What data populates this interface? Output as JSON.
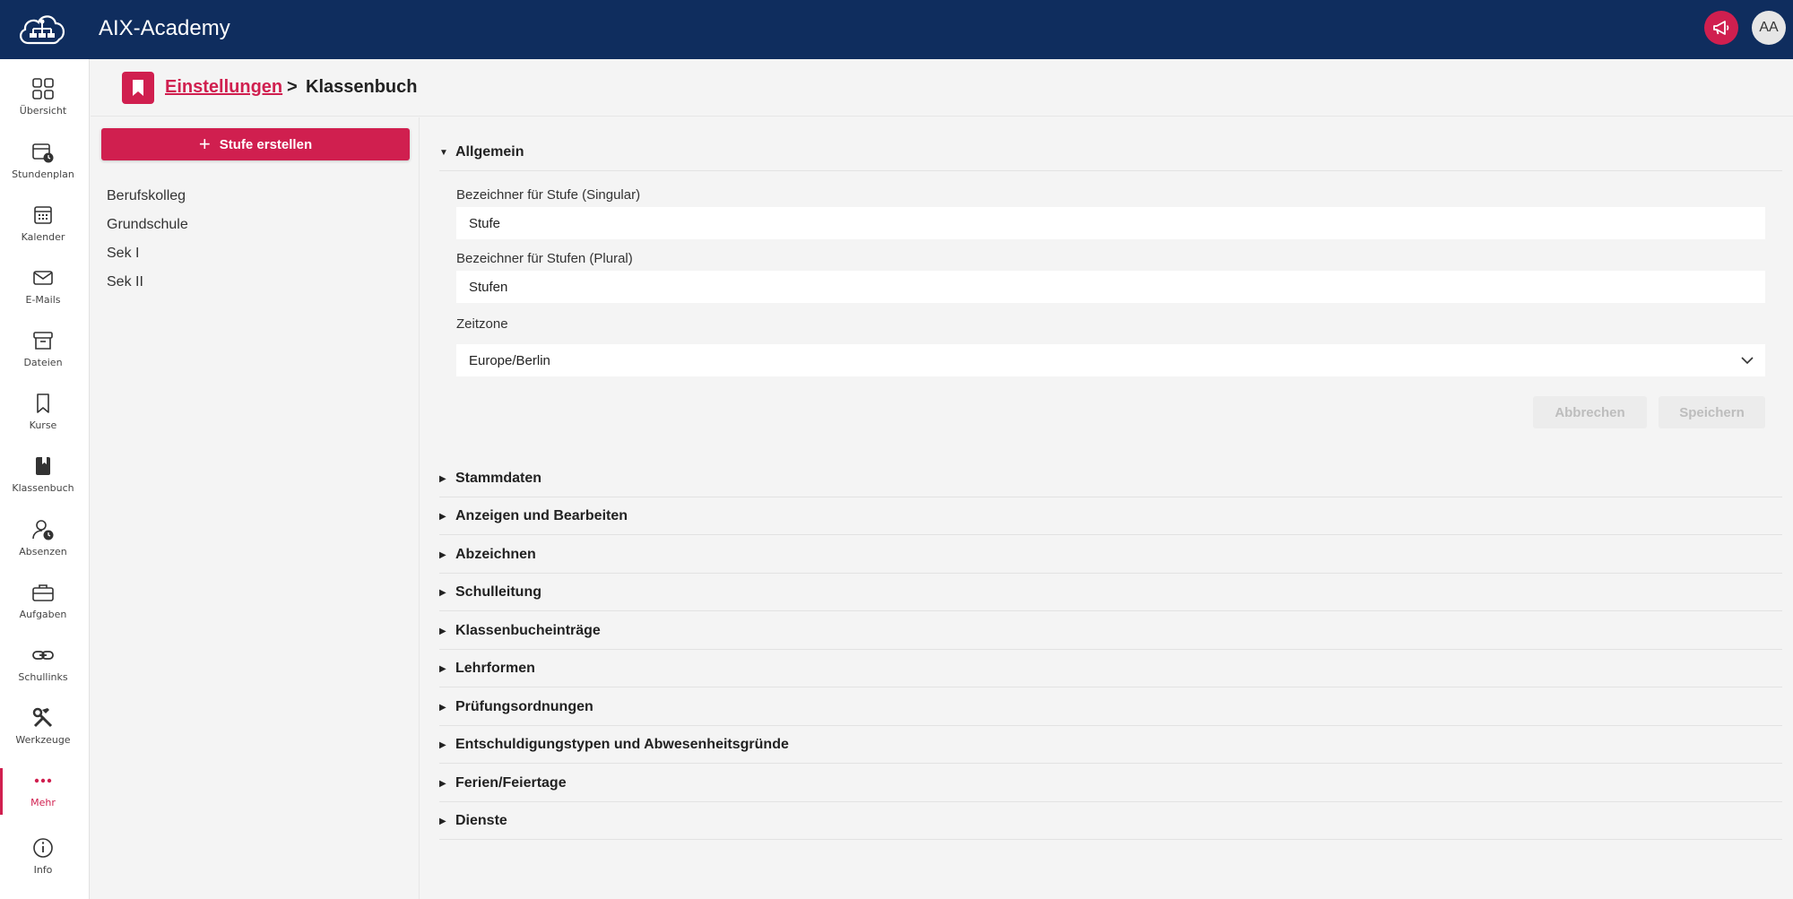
{
  "header": {
    "app_title": "AIX-Academy",
    "logo_icon": "cloud-network-icon",
    "announce_icon": "megaphone-icon",
    "avatar_initials": "AA",
    "brand_color": "#0f2d5e",
    "accent_color": "#d01f4f"
  },
  "sidebar": {
    "items": [
      {
        "label": "Übersicht",
        "icon": "grid-icon"
      },
      {
        "label": "Stundenplan",
        "icon": "schedule-icon"
      },
      {
        "label": "Kalender",
        "icon": "calendar-icon"
      },
      {
        "label": "E-Mails",
        "icon": "mail-icon"
      },
      {
        "label": "Dateien",
        "icon": "archive-icon"
      },
      {
        "label": "Kurse",
        "icon": "bookmark-icon"
      },
      {
        "label": "Klassenbuch",
        "icon": "book-icon"
      },
      {
        "label": "Absenzen",
        "icon": "user-clock-icon"
      },
      {
        "label": "Aufgaben",
        "icon": "briefcase-icon"
      },
      {
        "label": "Schullinks",
        "icon": "link-icon"
      },
      {
        "label": "Werkzeuge",
        "icon": "tools-icon"
      },
      {
        "label": "Mehr",
        "icon": "more-icon",
        "active": true
      },
      {
        "label": "Info",
        "icon": "info-icon"
      }
    ]
  },
  "breadcrumb": {
    "parent": "Einstellungen",
    "separator": ">",
    "current": "Klassenbuch"
  },
  "left_panel": {
    "create_button": "Stufe erstellen",
    "levels": [
      "Berufskolleg",
      "Grundschule",
      "Sek I",
      "Sek II"
    ]
  },
  "general": {
    "title": "Allgemein",
    "singular_label": "Bezeichner für Stufe (Singular)",
    "singular_value": "Stufe",
    "plural_label": "Bezeichner für Stufen (Plural)",
    "plural_value": "Stufen",
    "timezone_label": "Zeitzone",
    "timezone_value": "Europe/Berlin",
    "cancel_button": "Abbrechen",
    "save_button": "Speichern"
  },
  "sections": [
    "Stammdaten",
    "Anzeigen und Bearbeiten",
    "Abzeichnen",
    "Schulleitung",
    "Klassenbucheinträge",
    "Lehrformen",
    "Prüfungsordnungen",
    "Entschuldigungstypen und Abwesenheitsgründe",
    "Ferien/Feiertage",
    "Dienste"
  ]
}
